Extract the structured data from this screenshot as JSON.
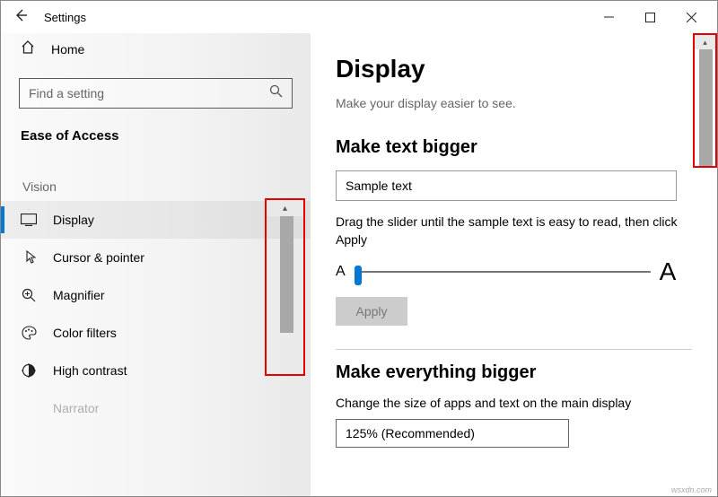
{
  "app": {
    "title": "Settings"
  },
  "sidebar": {
    "home_label": "Home",
    "search_placeholder": "Find a setting",
    "category_label": "Ease of Access",
    "group_label": "Vision",
    "items": [
      {
        "label": "Display"
      },
      {
        "label": "Cursor & pointer"
      },
      {
        "label": "Magnifier"
      },
      {
        "label": "Color filters"
      },
      {
        "label": "High contrast"
      },
      {
        "label": "Narrator"
      }
    ]
  },
  "page": {
    "title": "Display",
    "subtitle": "Make your display easier to see.",
    "section1": {
      "title": "Make text bigger",
      "sample": "Sample text",
      "slider_desc": "Drag the slider until the sample text is easy to read, then click Apply",
      "small_a": "A",
      "big_a": "A",
      "apply_label": "Apply"
    },
    "section2": {
      "title": "Make everything bigger",
      "desc": "Change the size of apps and text on the main display",
      "dropdown_value": "125% (Recommended)"
    }
  },
  "watermark": "wsxdn.com"
}
